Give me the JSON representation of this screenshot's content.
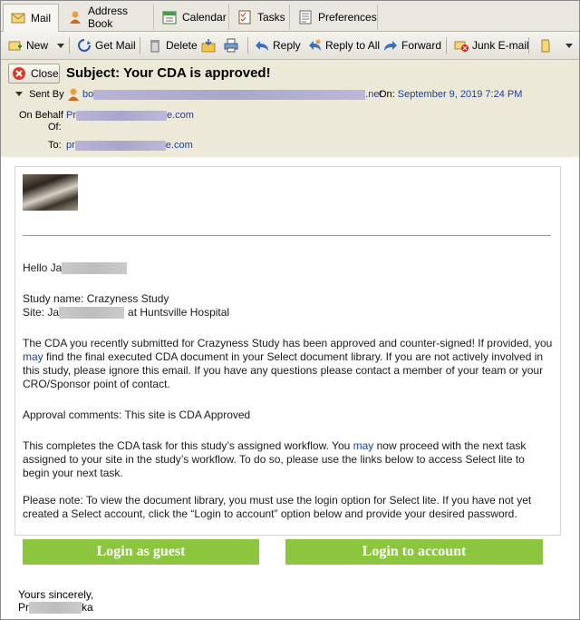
{
  "tabs": [
    {
      "label": "Mail",
      "icon": "mail-icon",
      "active": true
    },
    {
      "label": "Address Book",
      "icon": "address-book-icon"
    },
    {
      "label": "Calendar",
      "icon": "calendar-icon"
    },
    {
      "label": "Tasks",
      "icon": "tasks-icon"
    },
    {
      "label": "Preferences",
      "icon": "preferences-icon"
    }
  ],
  "toolbar": {
    "new": "New",
    "get_mail": "Get Mail",
    "delete": "Delete",
    "reply": "Reply",
    "reply_all": "Reply to All",
    "forward": "Forward",
    "junk": "Junk E-mail"
  },
  "header": {
    "close": "Close",
    "subject": "Subject: Your CDA is approved!",
    "sent_by_label": "Sent By",
    "sent_by_prefix": "bo",
    "sent_by_suffix": ".net",
    "on_label": "On:",
    "date": "September 9, 2019 7:24 PM",
    "on_behalf_label": "On Behalf",
    "of_label": "Of:",
    "on_behalf_prefix": "Pr",
    "on_behalf_suffix": "e.com",
    "to_label": "To:",
    "to_prefix": "pr",
    "to_suffix": "e.com"
  },
  "message": {
    "greeting": "Hello Ja",
    "study_name": "Study name: Crazyness Study",
    "site_prefix": "Site: Ja",
    "site_suffix": "at Huntsville Hospital",
    "para1_a": "The CDA you recently submitted for Crazyness Study has been approved and counter-signed! If provided, you ",
    "para1_may": "may",
    "para1_b": " find the final executed CDA document in your Select document library. If you are not actively involved in this study, please ignore this email. If you have any questions please contact a member of your team or your CRO/Sponsor point of contact.",
    "approval": "Approval comments: This site is CDA Approved",
    "para2_a": "This completes the CDA task for this study’s assigned workflow. You ",
    "para2_may": "may",
    "para2_b": " now proceed with the next task assigned to your site in the study’s workflow. To do so, please use the links below to access Select lite to begin your next task.",
    "note": "Please note: To view the document library, you must use the login option for Select lite. If you have not yet created a Select account, click the “Login to account” option below and provide your desired password.",
    "login_guest": "Login as guest",
    "login_account": "Login to account",
    "closing": "Yours sincerely,",
    "sig_prefix": "Pr",
    "sig_suffix": "ka"
  },
  "colors": {
    "accent_green": "#8cc63f",
    "link_blue": "#1c3f9a",
    "header_bg": "#ece9d8"
  }
}
